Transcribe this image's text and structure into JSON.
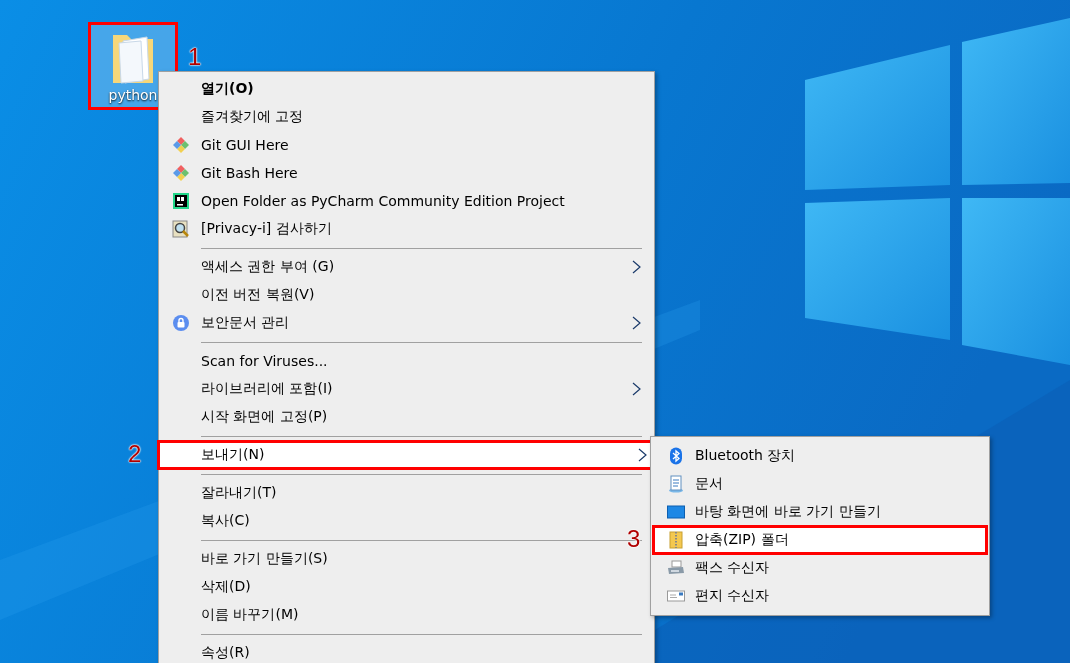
{
  "desktop_icon": {
    "label": "python",
    "highlighted": true,
    "callout": "1"
  },
  "menu": {
    "groups": [
      [
        {
          "label": "열기(O)",
          "kind": "plain",
          "bold": true,
          "submenu": false,
          "highlighted": false
        },
        {
          "label": "즐겨찾기에 고정",
          "kind": "plain",
          "bold": false,
          "submenu": false,
          "highlighted": false
        },
        {
          "label": "Git GUI Here",
          "kind": "git",
          "bold": false,
          "submenu": false,
          "highlighted": false
        },
        {
          "label": "Git Bash Here",
          "kind": "git",
          "bold": false,
          "submenu": false,
          "highlighted": false
        },
        {
          "label": "Open Folder as PyCharm Community Edition Project",
          "kind": "pycharm",
          "bold": false,
          "submenu": false,
          "highlighted": false
        },
        {
          "label": "[Privacy-i] 검사하기",
          "kind": "magnifier",
          "bold": false,
          "submenu": false,
          "highlighted": false
        }
      ],
      [
        {
          "label": "액세스 권한 부여 (G)",
          "kind": "plain",
          "bold": false,
          "submenu": true,
          "highlighted": false
        },
        {
          "label": "이전 버전 복원(V)",
          "kind": "plain",
          "bold": false,
          "submenu": false,
          "highlighted": false
        },
        {
          "label": "보안문서 관리",
          "kind": "lock",
          "bold": false,
          "submenu": true,
          "highlighted": false
        }
      ],
      [
        {
          "label": "Scan for Viruses...",
          "kind": "plain",
          "bold": false,
          "submenu": false,
          "highlighted": false
        },
        {
          "label": "라이브러리에 포함(I)",
          "kind": "plain",
          "bold": false,
          "submenu": true,
          "highlighted": false
        },
        {
          "label": "시작 화면에 고정(P)",
          "kind": "plain",
          "bold": false,
          "submenu": false,
          "highlighted": false
        }
      ],
      [
        {
          "label": "보내기(N)",
          "kind": "plain",
          "bold": false,
          "submenu": true,
          "highlighted": true,
          "callout": "2"
        }
      ],
      [
        {
          "label": "잘라내기(T)",
          "kind": "plain",
          "bold": false,
          "submenu": false,
          "highlighted": false
        },
        {
          "label": "복사(C)",
          "kind": "plain",
          "bold": false,
          "submenu": false,
          "highlighted": false
        }
      ],
      [
        {
          "label": "바로 가기 만들기(S)",
          "kind": "plain",
          "bold": false,
          "submenu": false,
          "highlighted": false
        },
        {
          "label": "삭제(D)",
          "kind": "plain",
          "bold": false,
          "submenu": false,
          "highlighted": false
        },
        {
          "label": "이름 바꾸기(M)",
          "kind": "plain",
          "bold": false,
          "submenu": false,
          "highlighted": false
        }
      ],
      [
        {
          "label": "속성(R)",
          "kind": "plain",
          "bold": false,
          "submenu": false,
          "highlighted": false
        }
      ]
    ]
  },
  "submenu": {
    "items": [
      {
        "label": "Bluetooth 장치",
        "kind": "bluetooth",
        "highlighted": false
      },
      {
        "label": "문서",
        "kind": "document",
        "highlighted": false
      },
      {
        "label": "바탕 화면에 바로 가기 만들기",
        "kind": "desktop",
        "highlighted": false
      },
      {
        "label": "압축(ZIP) 폴더",
        "kind": "zip",
        "highlighted": true,
        "callout": "3"
      },
      {
        "label": "팩스 수신자",
        "kind": "fax",
        "highlighted": false
      },
      {
        "label": "편지 수신자",
        "kind": "mail",
        "highlighted": false
      }
    ]
  }
}
